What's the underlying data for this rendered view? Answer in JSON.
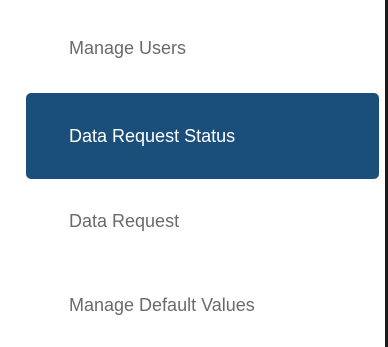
{
  "nav": {
    "items": [
      {
        "label": "Manage Users",
        "active": false
      },
      {
        "label": "Data Request Status",
        "active": true
      },
      {
        "label": "Data Request",
        "active": false
      },
      {
        "label": "Manage Default Values",
        "active": false
      }
    ]
  },
  "colors": {
    "active_background": "#1a4f7c",
    "active_text": "#ffffff",
    "inactive_text": "#6a6a6a",
    "border": "#1b1b1b"
  }
}
